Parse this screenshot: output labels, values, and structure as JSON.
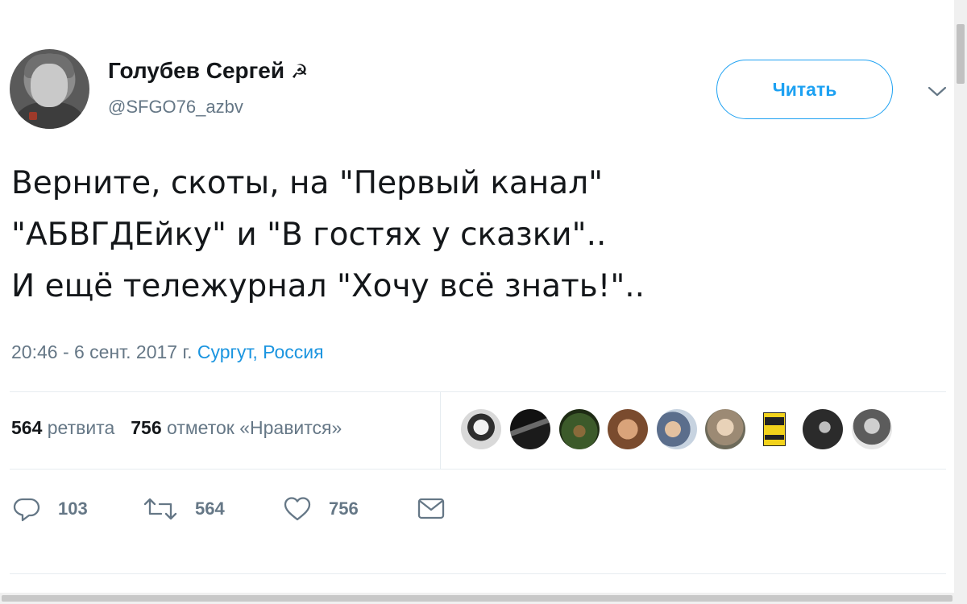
{
  "author": {
    "name": "Голубев Сергей",
    "name_emoji": "☭",
    "handle": "@SFGO76_azbv"
  },
  "follow_button": {
    "label": "Читать"
  },
  "menu": {
    "icon": "chevron-down-icon"
  },
  "tweet": {
    "lines": [
      "Верните, скоты, на \"Первый канал\"",
      "\"АБВГДЕйку\" и \"В гостях у сказки\"..",
      "И ещё тележурнал \"Хочу всё знать!\".."
    ]
  },
  "meta": {
    "timestamp": "20:46 - 6 сент. 2017 г.",
    "location": "Сургут, Россия"
  },
  "stats": {
    "retweets_count": "564",
    "retweets_label": "ретвита",
    "likes_count": "756",
    "likes_label": "отметок «Нравится»"
  },
  "likers": [
    "liker-avatar-1",
    "liker-avatar-2",
    "liker-avatar-3",
    "liker-avatar-4",
    "liker-avatar-5",
    "liker-avatar-6",
    "liker-avatar-7",
    "liker-avatar-8",
    "liker-avatar-9"
  ],
  "actions": {
    "reply": {
      "icon": "reply-icon",
      "count": "103"
    },
    "retweet": {
      "icon": "retweet-icon",
      "count": "564"
    },
    "like": {
      "icon": "heart-icon",
      "count": "756"
    },
    "dm": {
      "icon": "envelope-icon"
    }
  },
  "colors": {
    "accent": "#1da1f2",
    "link": "#1b95e0",
    "muted": "#657786",
    "text": "#14171a"
  }
}
